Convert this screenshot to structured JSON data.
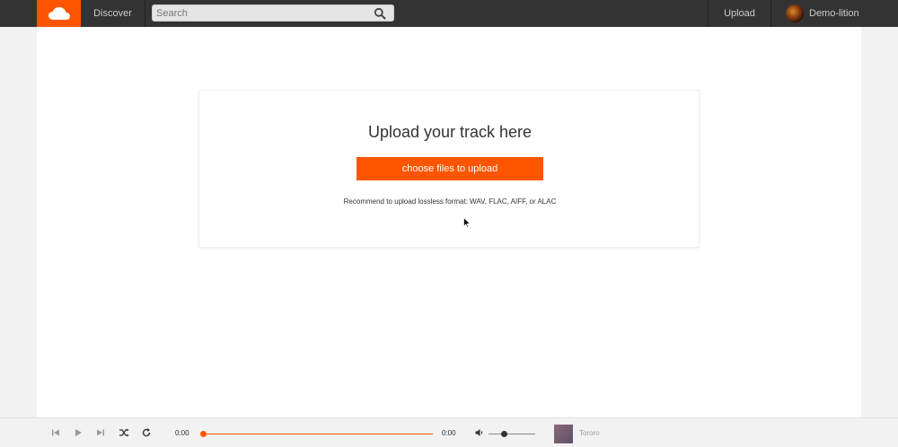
{
  "nav": {
    "logo_icon": "soundcloud-cloud-icon",
    "discover_label": "Discover",
    "search_placeholder": "Search",
    "upload_label": "Upload",
    "username": "Demo-lition"
  },
  "upload": {
    "title": "Upload your track here",
    "button_label": "choose files to upload",
    "note": "Recommend to upload lossless format: WAV, FLAC, AIFF, or ALAC"
  },
  "player": {
    "current_time": "0:00",
    "total_time": "0:00",
    "track_title": "Tororo"
  },
  "colors": {
    "accent": "#ff5500",
    "nav_bg": "#333333"
  }
}
